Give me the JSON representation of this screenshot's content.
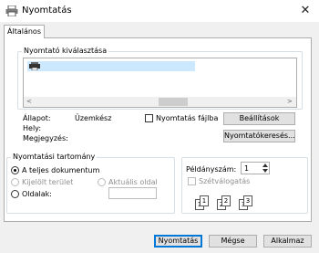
{
  "window": {
    "title": "Nyomtatás",
    "close_glyph": "✕"
  },
  "tabs": [
    {
      "label": "Általános",
      "active": true
    }
  ],
  "printer_selection": {
    "group_title": "Nyomtató kiválasztása",
    "selected_item_icon": "printer-icon",
    "scroll_left": "<",
    "scroll_right": ">"
  },
  "status": {
    "state_label": "Állapot:",
    "state_value": "Üzemkész",
    "location_label": "Hely:",
    "comment_label": "Megjegyzés:",
    "print_to_file_label": "Nyomtatás fájlba",
    "print_to_file_checked": false,
    "settings_button": "Beállítások",
    "find_printer_button": "Nyomtatókeresés..."
  },
  "page_range": {
    "group_title": "Nyomtatási tartomány",
    "all_documents": "A teljes dokumentum",
    "selection": "Kijelölt terület",
    "current_page": "Aktuális oldal",
    "pages": "Oldalak:",
    "pages_value": "",
    "selected": "all_documents"
  },
  "copies": {
    "label": "Példányszám:",
    "value": "1",
    "collate_label": "Szétválogatás",
    "collate_checked": false,
    "collate_pages": [
      "1",
      "1",
      "2",
      "2",
      "3",
      "3"
    ]
  },
  "buttons": {
    "print": "Nyomtatás",
    "cancel": "Mégse",
    "apply": "Alkalmaz"
  }
}
